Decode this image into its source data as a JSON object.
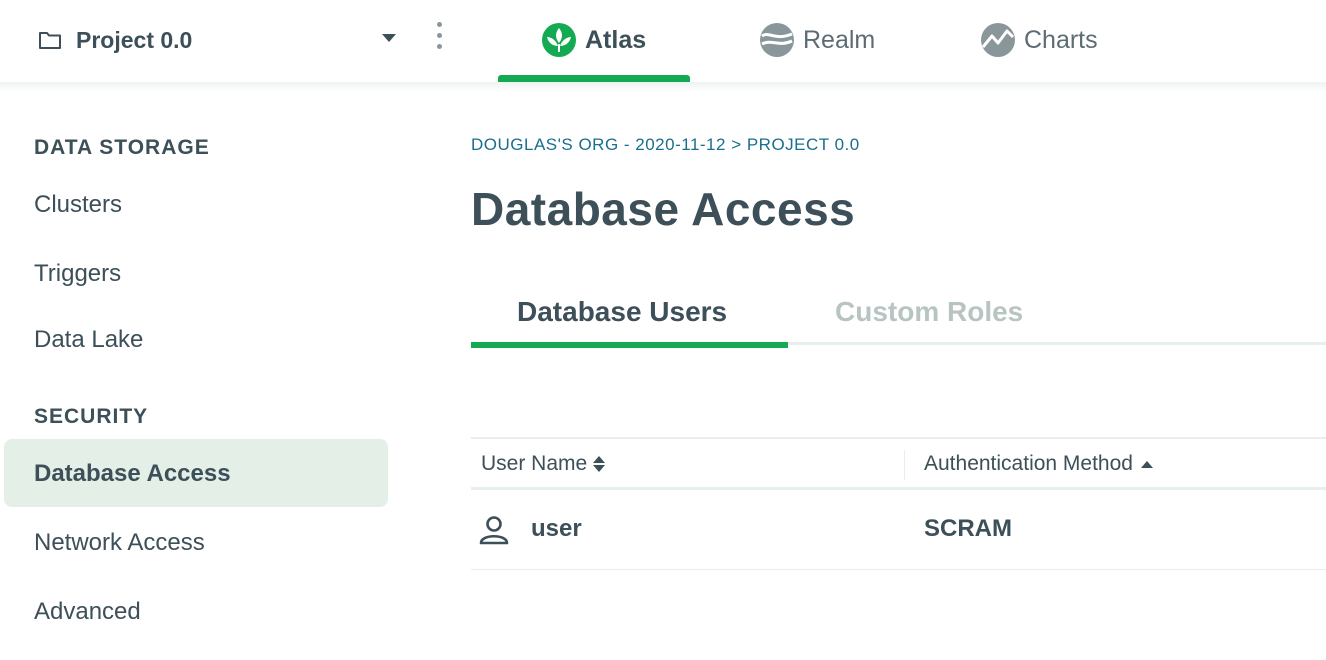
{
  "colors": {
    "accent_green": "#13aa52",
    "text_dark": "#3d4f58",
    "link_blue": "#1a6e8e",
    "inactive_tab": "#b8c4c2",
    "active_sidebar_bg": "#e4efe8"
  },
  "topbar": {
    "project": {
      "icon": "folder-icon",
      "name": "Project 0.0",
      "dropdown_icon": "caret-down-icon"
    },
    "more_icon": "kebab-menu-icon",
    "tabs": [
      {
        "label": "Atlas",
        "icon": "atlas-leaf-icon",
        "active": true
      },
      {
        "label": "Realm",
        "icon": "realm-icon",
        "active": false
      },
      {
        "label": "Charts",
        "icon": "charts-icon",
        "active": false
      }
    ]
  },
  "sidebar": {
    "sections": [
      {
        "title": "DATA STORAGE",
        "items": [
          {
            "label": "Clusters"
          },
          {
            "label": "Triggers"
          },
          {
            "label": "Data Lake"
          }
        ]
      },
      {
        "title": "SECURITY",
        "items": [
          {
            "label": "Database Access",
            "active": true
          },
          {
            "label": "Network Access"
          },
          {
            "label": "Advanced"
          }
        ]
      }
    ]
  },
  "main": {
    "breadcrumb": "DOUGLAS'S ORG - 2020-11-12 > PROJECT 0.0",
    "title": "Database Access",
    "tabs": [
      {
        "label": "Database Users",
        "active": true
      },
      {
        "label": "Custom Roles",
        "active": false
      }
    ],
    "table": {
      "columns": [
        {
          "label": "User Name",
          "sort": "both"
        },
        {
          "label": "Authentication Method",
          "sort": "ascending"
        }
      ],
      "rows": [
        {
          "icon": "user-icon",
          "user_name": "user",
          "auth_method": "SCRAM"
        }
      ]
    }
  }
}
